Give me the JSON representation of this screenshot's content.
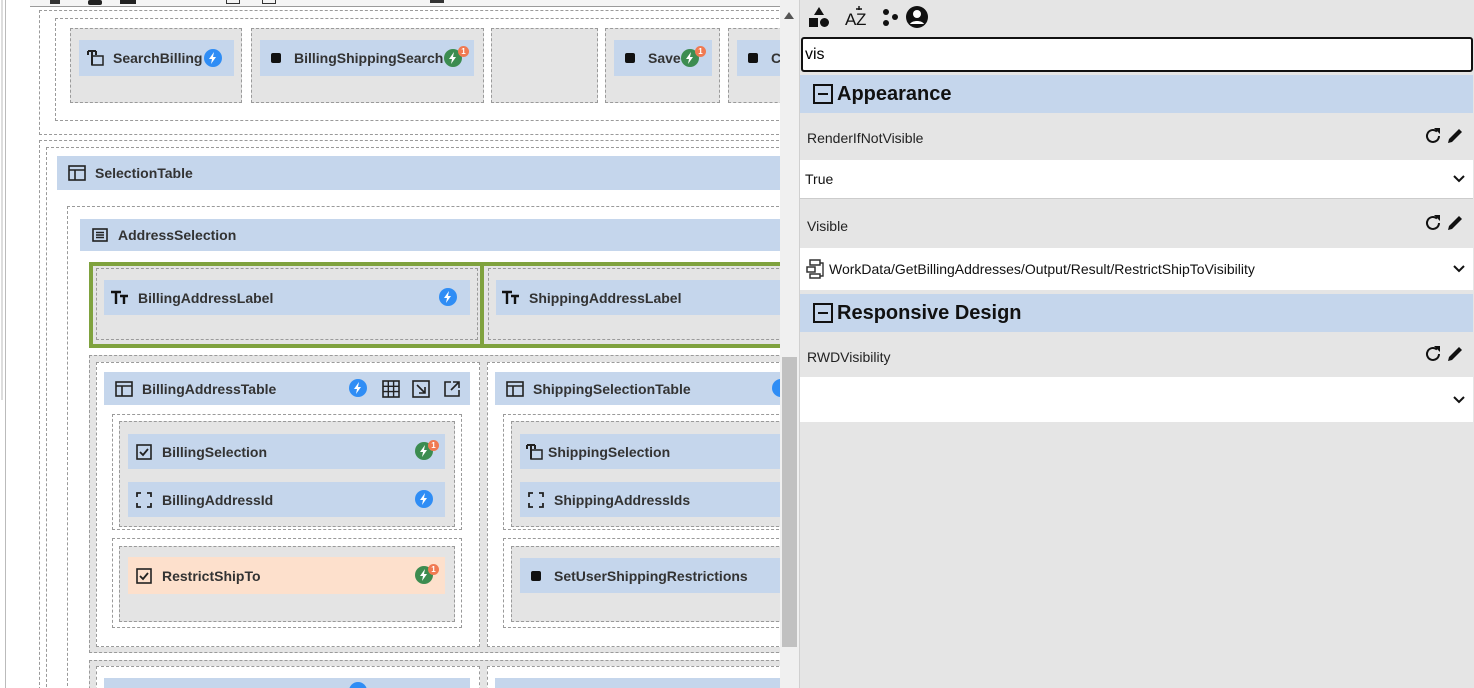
{
  "canvas": {
    "top_row": {
      "search_billing": "SearchBilling",
      "billing_shipping_search": "BillingShippingSearch",
      "save": "Save",
      "cancel_partial": "C",
      "badge": "1"
    },
    "selection_table": "SelectionTable",
    "address_selection": "AddressSelection",
    "billing_address_label": "BillingAddressLabel",
    "shipping_address_label": "ShippingAddressLabel",
    "billing_address_table": "BillingAddressTable",
    "shipping_selection_table": "ShippingSelectionTable",
    "billing_selection": "BillingSelection",
    "billing_address_id": "BillingAddressId",
    "shipping_selection": "ShippingSelection",
    "shipping_address_ids": "ShippingAddressIds",
    "restrict_ship_to": "RestrictShipTo",
    "set_user_shipping_restrictions": "SetUserShippingRestrictions",
    "badge": "1"
  },
  "panel": {
    "toolbar_icons": [
      "shapes-icon",
      "sort-az-icon",
      "dots-icon",
      "account-icon"
    ],
    "search": {
      "value": "vis"
    },
    "sections": {
      "appearance": "Appearance",
      "responsive": "Responsive Design"
    },
    "props": {
      "render_if_not_visible": {
        "label": "RenderIfNotVisible",
        "value": "True"
      },
      "visible": {
        "label": "Visible",
        "value": "WorkData/GetBillingAddresses/Output/Result/RestrictShipToVisibility"
      },
      "rwd_visibility": {
        "label": "RWDVisibility",
        "value": ""
      }
    }
  },
  "colors": {
    "header_blue": "#c5d6ec",
    "highlight_green": "#7fa23e",
    "bolt_blue": "#2f8df5",
    "bolt_green": "#3c8c50",
    "badge_orange": "#f07a52",
    "restrict_bg": "#fde0cc"
  }
}
